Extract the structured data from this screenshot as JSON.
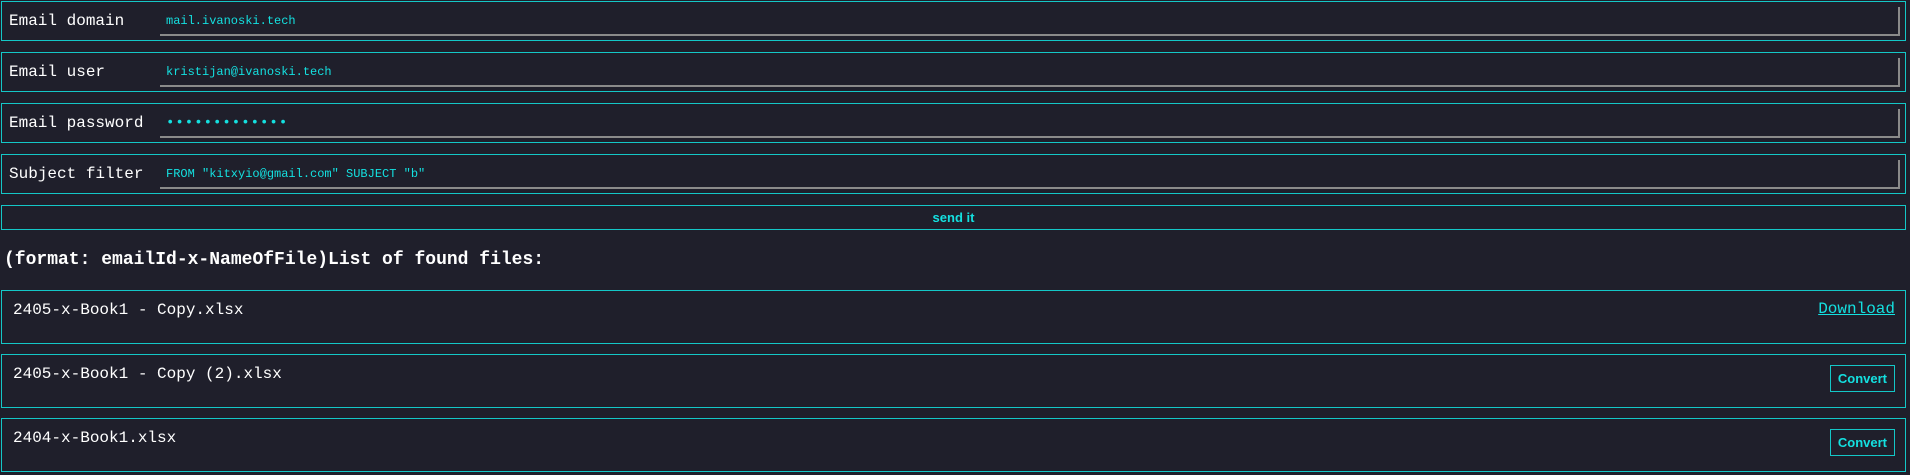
{
  "form": {
    "email_domain": {
      "label": "Email domain",
      "value": "mail.ivanoski.tech"
    },
    "email_user": {
      "label": "Email user",
      "value": "kristijan@ivanoski.tech"
    },
    "email_password": {
      "label": "Email password",
      "value": "•••••••••••••"
    },
    "subject_filter": {
      "label": "Subject filter",
      "value": "FROM \"kitxyio@gmail.com\" SUBJECT \"b\""
    },
    "send_label": "send it"
  },
  "files_heading": "(format: emailId-x-NameOfFile)List of found files:",
  "files": [
    {
      "name": "2405-x-Book1 - Copy.xlsx",
      "action": "Download",
      "action_type": "link"
    },
    {
      "name": "2405-x-Book1 - Copy (2).xlsx",
      "action": "Convert",
      "action_type": "button"
    },
    {
      "name": "2404-x-Book1.xlsx",
      "action": "Convert",
      "action_type": "button"
    }
  ],
  "colors": {
    "background": "#1f1f2b",
    "accent": "#14c7c7",
    "text": "#ffffff"
  }
}
